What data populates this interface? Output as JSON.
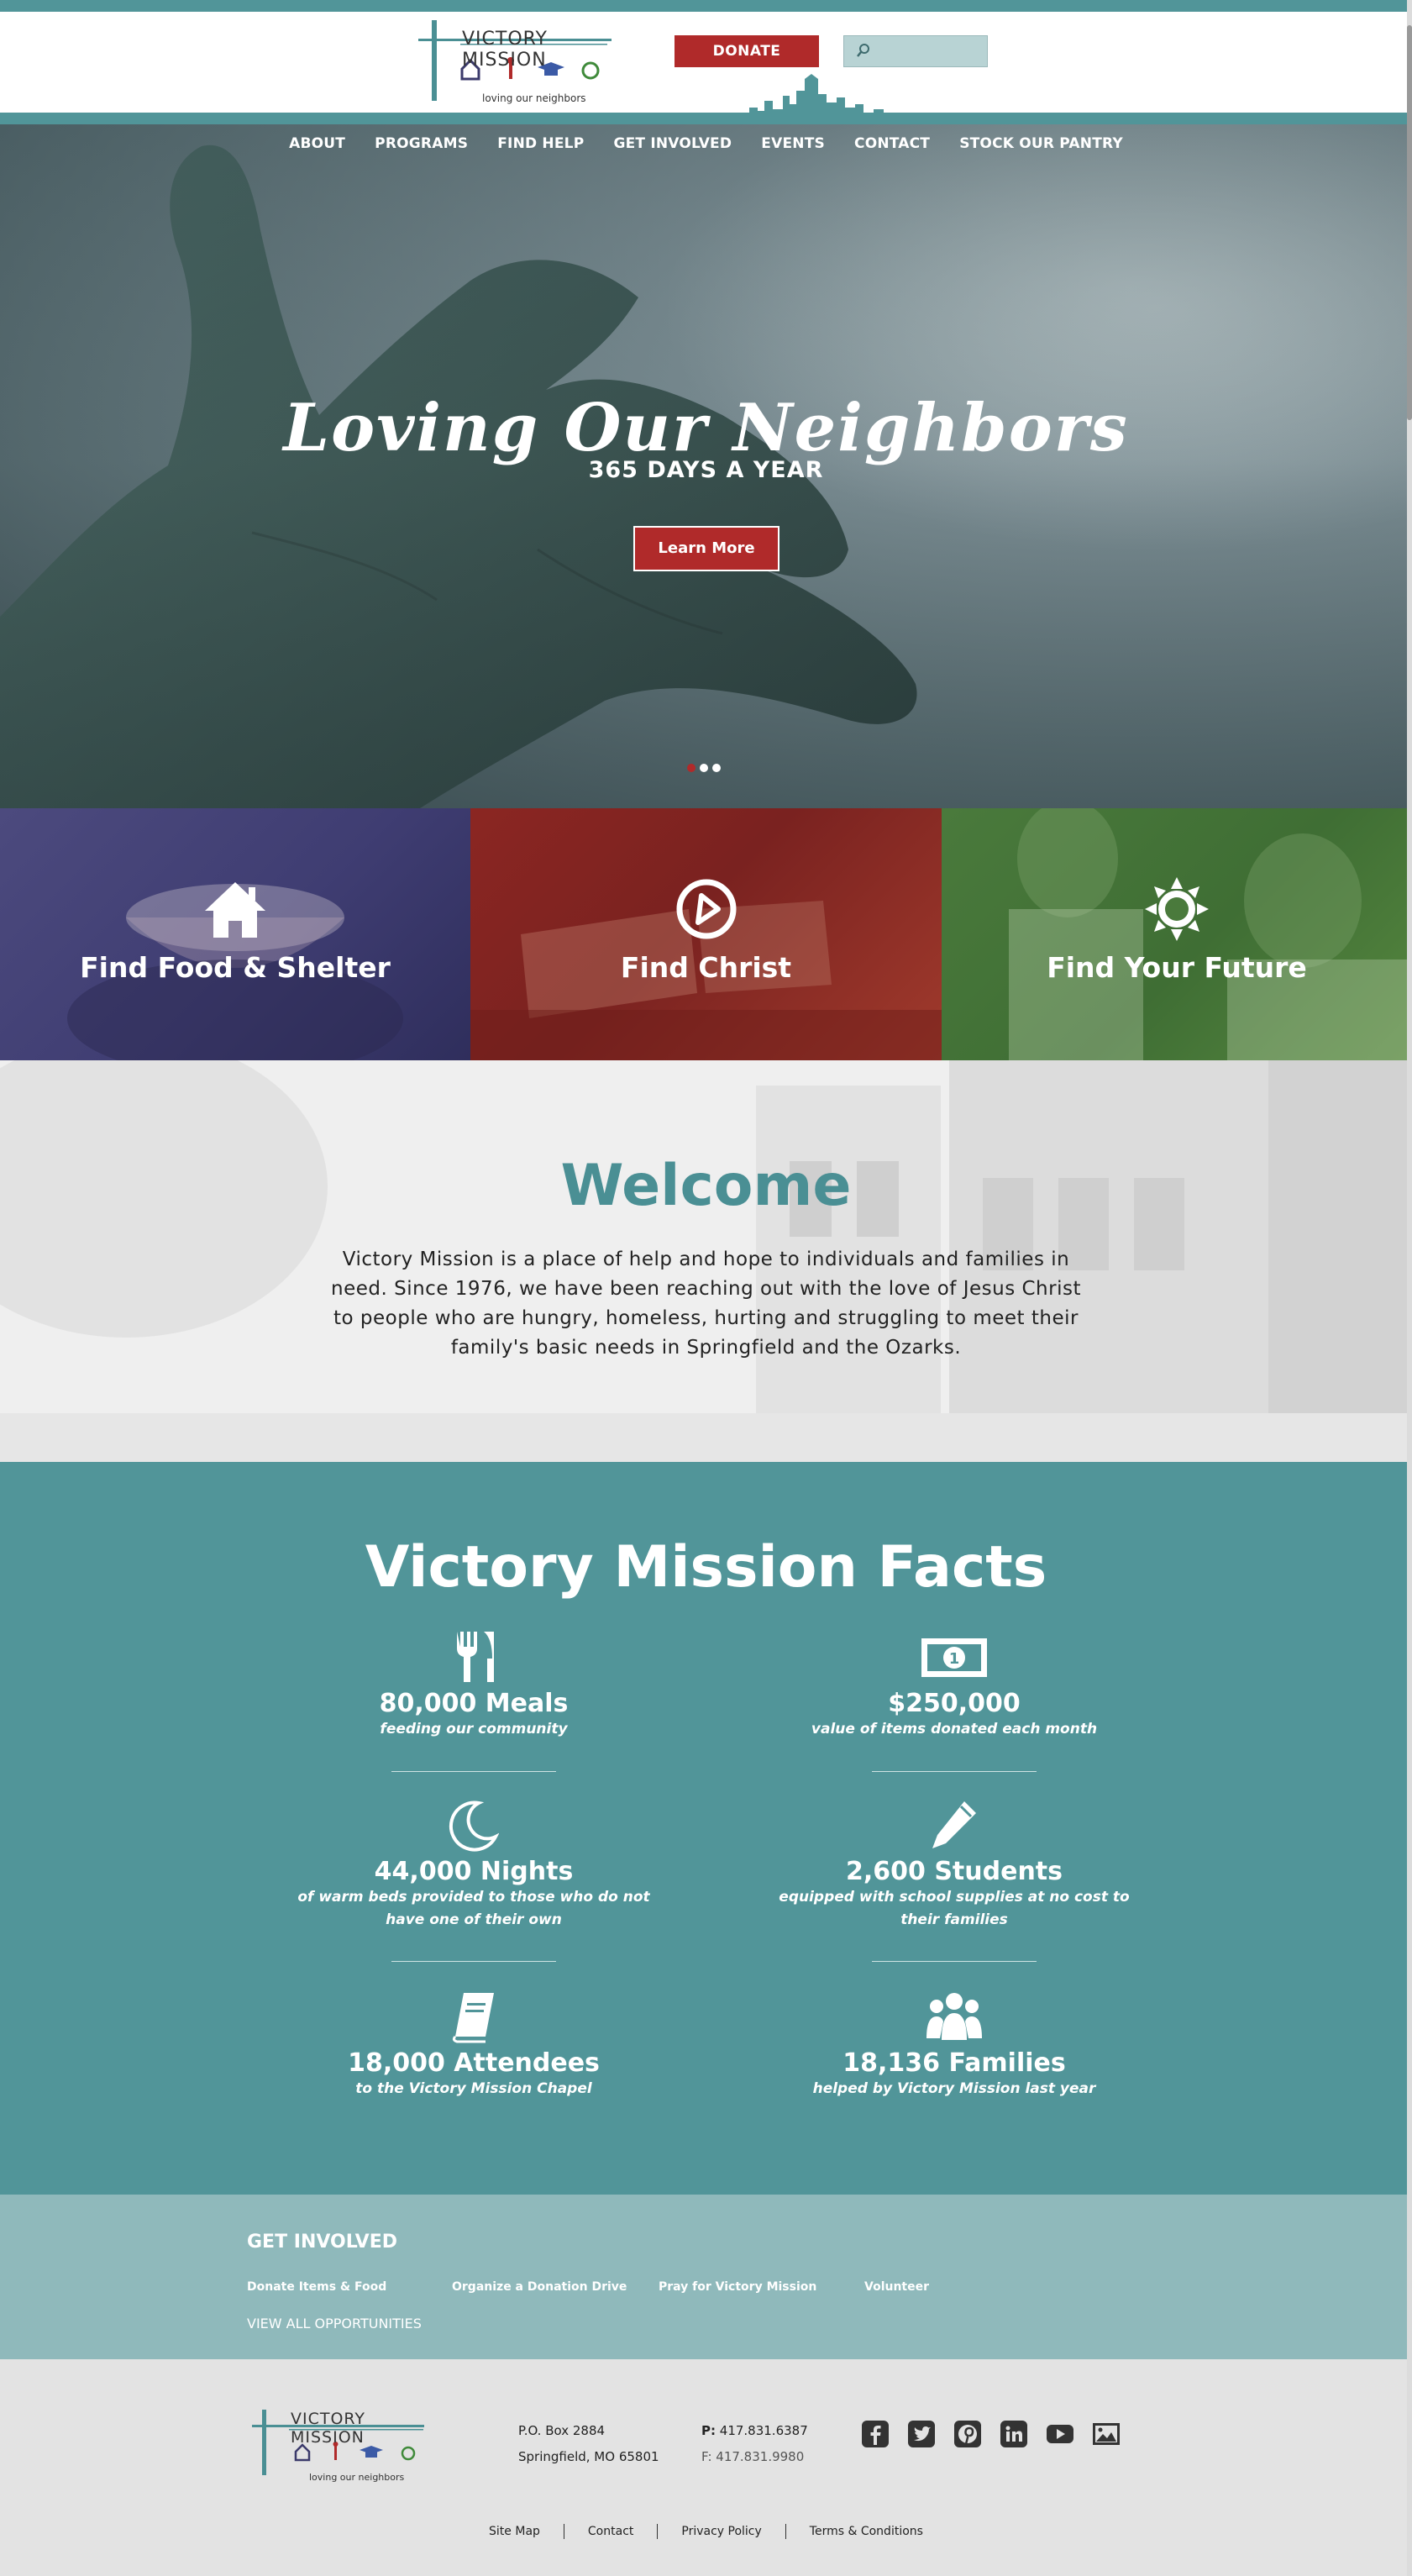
{
  "header": {
    "logo_title": "VICTORY MISSION",
    "logo_tagline": "loving our neighbors",
    "donate_label": "DONATE",
    "search_placeholder": ""
  },
  "nav": {
    "items": [
      {
        "label": "ABOUT"
      },
      {
        "label": "PROGRAMS"
      },
      {
        "label": "FIND HELP"
      },
      {
        "label": "GET INVOLVED"
      },
      {
        "label": "EVENTS"
      },
      {
        "label": "CONTACT"
      },
      {
        "label": "STOCK OUR PANTRY"
      }
    ]
  },
  "hero": {
    "title": "Loving Our Neighbors",
    "subtitle": "365 DAYS A YEAR",
    "button_label": "Learn More",
    "slides": 3,
    "active_slide": 1
  },
  "tiles": [
    {
      "label": "Find Food & Shelter",
      "icon": "house-icon",
      "color": "#4c4a7e"
    },
    {
      "label": "Find Christ",
      "icon": "compass-icon",
      "color": "#8b2622"
    },
    {
      "label": "Find Your Future",
      "icon": "sun-gear-icon",
      "color": "#4a7a3c"
    }
  ],
  "welcome": {
    "title": "Welcome",
    "text": "Victory Mission is a place of help and hope to individuals and families in need. Since 1976, we have been reaching out with the love of Jesus Christ to people who are hungry, homeless, hurting and struggling to meet their family's basic needs in Springfield and the Ozarks."
  },
  "facts": {
    "title": "Victory Mission Facts",
    "items": [
      {
        "number": "80,000 Meals",
        "desc": "feeding our community",
        "icon": "fork-knife-icon"
      },
      {
        "number": "$250,000",
        "desc": "value of items donated each month",
        "icon": "dollar-bill-icon"
      },
      {
        "number": "44,000 Nights",
        "desc": "of warm beds provided to those who do not have one of their own",
        "icon": "moon-icon"
      },
      {
        "number": "2,600 Students",
        "desc": "equipped with school supplies at no cost to their families",
        "icon": "pencil-icon"
      },
      {
        "number": "18,000 Attendees",
        "desc": "to the Victory Mission Chapel",
        "icon": "book-icon"
      },
      {
        "number": "18,136 Families",
        "desc": "helped by Victory Mission last year",
        "icon": "people-icon"
      }
    ]
  },
  "involved": {
    "title": "GET INVOLVED",
    "links": [
      {
        "label": "Donate Items & Food"
      },
      {
        "label": "Organize a Donation Drive"
      },
      {
        "label": "Pray for Victory Mission"
      },
      {
        "label": "Volunteer"
      }
    ],
    "view_all": "VIEW ALL OPPORTUNITIES"
  },
  "footer": {
    "logo_title": "VICTORY MISSION",
    "logo_tagline": "loving our neighbors",
    "address_line1": "P.O. Box 2884",
    "address_line2": "Springfield, MO 65801",
    "phone_label": "P:",
    "phone": "417.831.6387",
    "fax": "F: 417.831.9980",
    "socials": [
      "facebook-icon",
      "twitter-icon",
      "pinterest-icon",
      "linkedin-icon",
      "youtube-icon",
      "gallery-icon"
    ],
    "links": [
      {
        "label": "Site Map"
      },
      {
        "label": "Contact"
      },
      {
        "label": "Privacy Policy"
      },
      {
        "label": "Terms & Conditions"
      }
    ]
  },
  "colors": {
    "teal": "#519599",
    "red": "#b02a2a",
    "light_teal": "#8fb9bb",
    "welcome_title": "#4a8f94"
  }
}
